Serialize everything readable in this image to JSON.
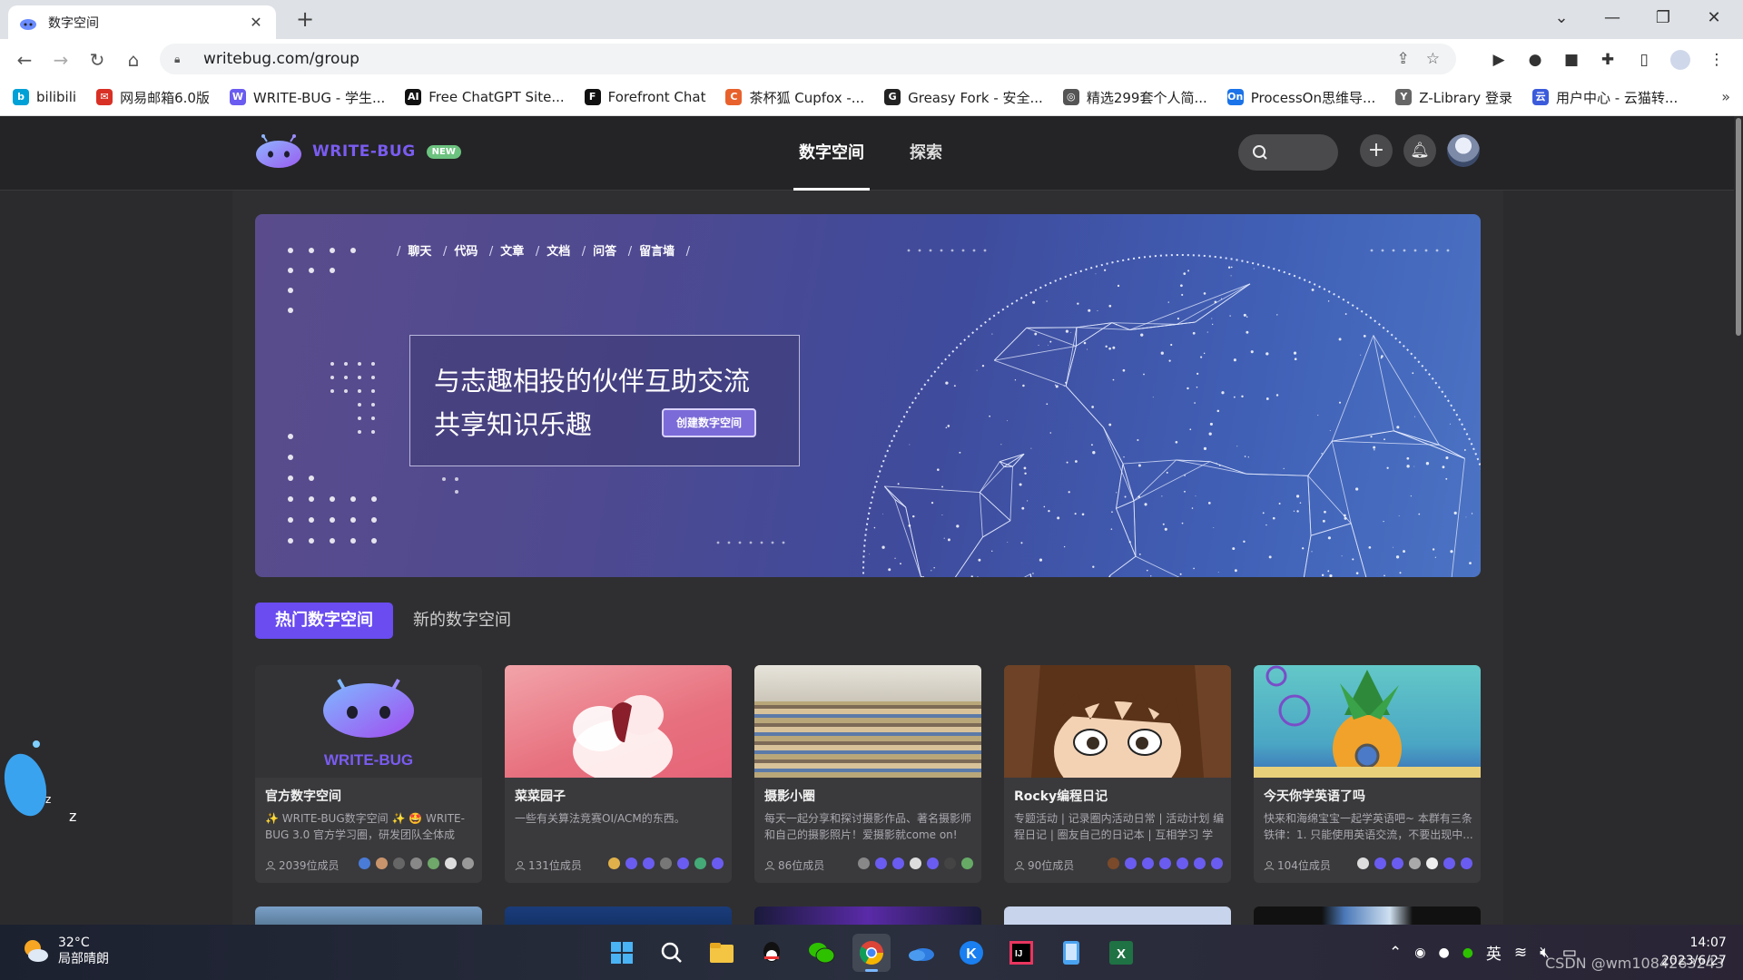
{
  "browser": {
    "tab_title": "数字空间",
    "url": "writebug.com/group",
    "bookmarks": [
      {
        "label": "bilibili",
        "color": "#00a1d6",
        "glyph": "b"
      },
      {
        "label": "网易邮箱6.0版",
        "color": "#d93025",
        "glyph": "✉"
      },
      {
        "label": "WRITE-BUG - 学生...",
        "color": "#6a5cf0",
        "glyph": "W"
      },
      {
        "label": "Free ChatGPT Site...",
        "color": "#111111",
        "glyph": "AI"
      },
      {
        "label": "Forefront Chat",
        "color": "#111111",
        "glyph": "F"
      },
      {
        "label": "茶杯狐 Cupfox -...",
        "color": "#e8612c",
        "glyph": "C"
      },
      {
        "label": "Greasy Fork - 安全...",
        "color": "#222222",
        "glyph": "G"
      },
      {
        "label": "精选299套个人简...",
        "color": "#555555",
        "glyph": "◎"
      },
      {
        "label": "ProcessOn思维导...",
        "color": "#1a73e8",
        "glyph": "On"
      },
      {
        "label": "Z-Library 登录",
        "color": "#666666",
        "glyph": "Y"
      },
      {
        "label": "用户中心 - 云猫转...",
        "color": "#3b5bdb",
        "glyph": "云"
      }
    ]
  },
  "site": {
    "brand": "WRITE-BUG",
    "new_badge": "NEW",
    "nav": [
      {
        "label": "数字空间",
        "active": true
      },
      {
        "label": "探索",
        "active": false
      }
    ],
    "banner": {
      "crumbs": [
        "聊天",
        "代码",
        "文章",
        "文档",
        "问答",
        "留言墙"
      ],
      "headline_1": "与志趣相投的伙伴互助交流",
      "headline_2": "共享知识乐趣",
      "cta": "创建数字空间"
    },
    "tabs": [
      {
        "label": "热门数字空间",
        "active": true
      },
      {
        "label": "新的数字空间",
        "active": false
      }
    ],
    "cards": [
      {
        "title": "官方数字空间",
        "desc": "✨ WRITE-BUG数字空间 ✨ 🤩 WRITE-BUG 3.0 官方学习圈，研发团队全体成员...",
        "members": "2039位成员",
        "cover": "official"
      },
      {
        "title": "菜菜园子",
        "desc": "一些有关算法竞赛OI/ACM的东西。",
        "members": "131位成员",
        "cover": "pink"
      },
      {
        "title": "摄影小圈",
        "desc": "每天一起分享和探讨摄影作品、著名摄影师和自己的摄影照片！爱摄影就come on!",
        "members": "86位成员",
        "cover": "market"
      },
      {
        "title": "Rocky编程日记",
        "desc": "专题活动 | 记录圈内活动日常 | 活动计划 编程日记 | 圈友自己的日记本 | 互相学习 学习...",
        "members": "90位成员",
        "cover": "anime"
      },
      {
        "title": "今天你学英语了吗",
        "desc": "快来和海绵宝宝一起学英语吧~ 本群有三条铁律：1. 只能使用英语交流，不要出现中...",
        "members": "104位成员",
        "cover": "sponge"
      }
    ]
  },
  "taskbar": {
    "temp": "32°C",
    "weather": "局部晴朗",
    "time": "14:07",
    "date": "2023/6/27",
    "ime": "英"
  },
  "watermark": "CSDN @wm1084263243"
}
